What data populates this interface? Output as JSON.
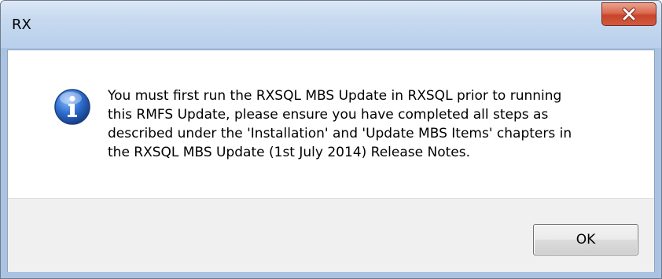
{
  "window": {
    "title": "RX"
  },
  "titlebar": {
    "close_icon": "close-icon",
    "close_symbol": "✕"
  },
  "dialog": {
    "icon": "info-icon",
    "message": "You must first run the RXSQL MBS Update in RXSQL prior to running\nthis RMFS Update, please ensure you have completed all steps as\ndescribed under the 'Installation' and 'Update MBS Items' chapters in\nthe RXSQL MBS Update (1st July 2014) Release Notes."
  },
  "buttons": {
    "ok_label": "OK"
  },
  "colors": {
    "close_button": "#c9442b",
    "info_icon": "#2a5db0",
    "footer_bg": "#f0f0f0"
  }
}
